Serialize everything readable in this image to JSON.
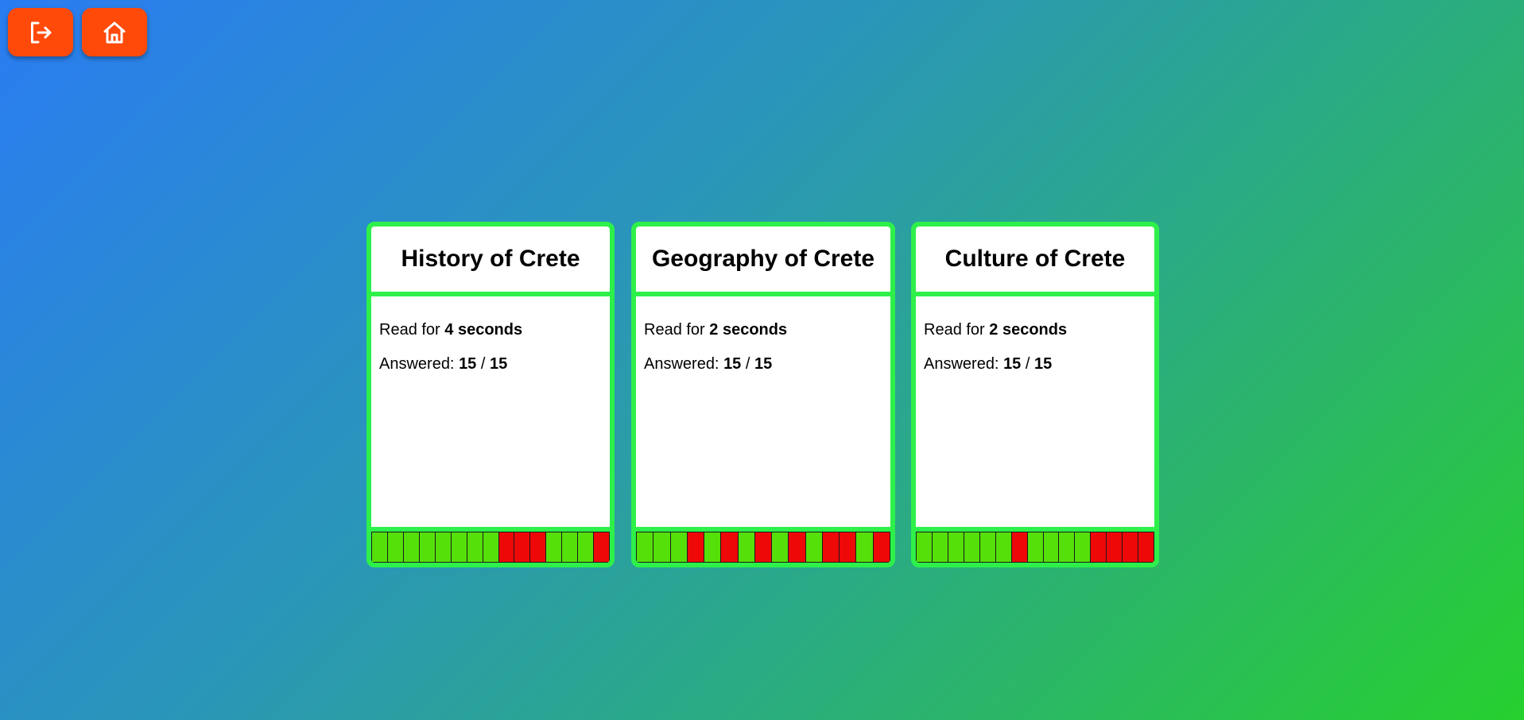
{
  "nav": {
    "logout_icon": "logout-icon",
    "home_icon": "home-icon",
    "button_color": "#ff4a0a"
  },
  "labels": {
    "read_prefix": "Read for ",
    "answered_prefix": "Answered: ",
    "answered_separator": " / "
  },
  "colors": {
    "correct": "#55e00a",
    "incorrect": "#ee0808",
    "card_border": "#2ef04a"
  },
  "cards": [
    {
      "title": "History of Crete",
      "read_time": "4 seconds",
      "answered": "15",
      "total": "15",
      "results": [
        1,
        1,
        1,
        1,
        1,
        1,
        1,
        1,
        0,
        0,
        0,
        1,
        1,
        1,
        0
      ]
    },
    {
      "title": "Geography of Crete",
      "read_time": "2 seconds",
      "answered": "15",
      "total": "15",
      "results": [
        1,
        1,
        1,
        0,
        1,
        0,
        1,
        0,
        1,
        0,
        1,
        0,
        0,
        1,
        0
      ]
    },
    {
      "title": "Culture of Crete",
      "read_time": "2 seconds",
      "answered": "15",
      "total": "15",
      "results": [
        1,
        1,
        1,
        1,
        1,
        1,
        0,
        1,
        1,
        1,
        1,
        0,
        0,
        0,
        0
      ]
    }
  ]
}
